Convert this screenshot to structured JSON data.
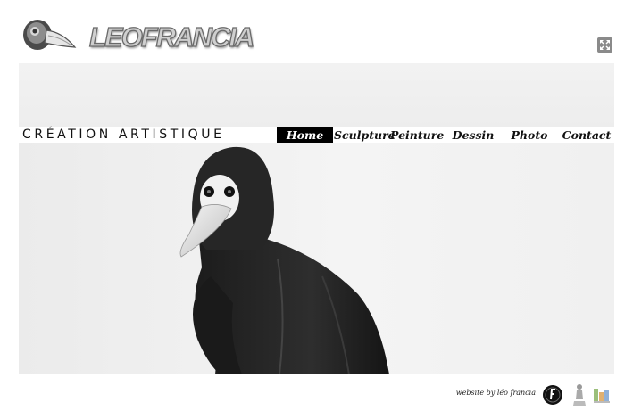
{
  "header": {
    "logo_text": "LEOFRANCIA",
    "logo_icon": "plague-mask-logo-icon",
    "fullscreen_icon": "fullscreen-icon"
  },
  "nav": {
    "tagline": "CRÉATION ARTISTIQUE",
    "items": [
      {
        "label": "Home",
        "active": true
      },
      {
        "label": "Sculpture"
      },
      {
        "label": "Peinture"
      },
      {
        "label": "Dessin"
      },
      {
        "label": "Photo"
      },
      {
        "label": "Contact"
      }
    ]
  },
  "hero": {
    "image": "plague-doctor-photo"
  },
  "footer": {
    "credit": "website by léo francia",
    "icons": [
      "francia-circle-logo-icon",
      "statue-icon",
      "multicolor-logo-icon"
    ]
  },
  "colors": {
    "active_nav_bg": "#000000",
    "active_nav_text": "#ffffff",
    "text": "#111111",
    "banner": "#efefef"
  }
}
